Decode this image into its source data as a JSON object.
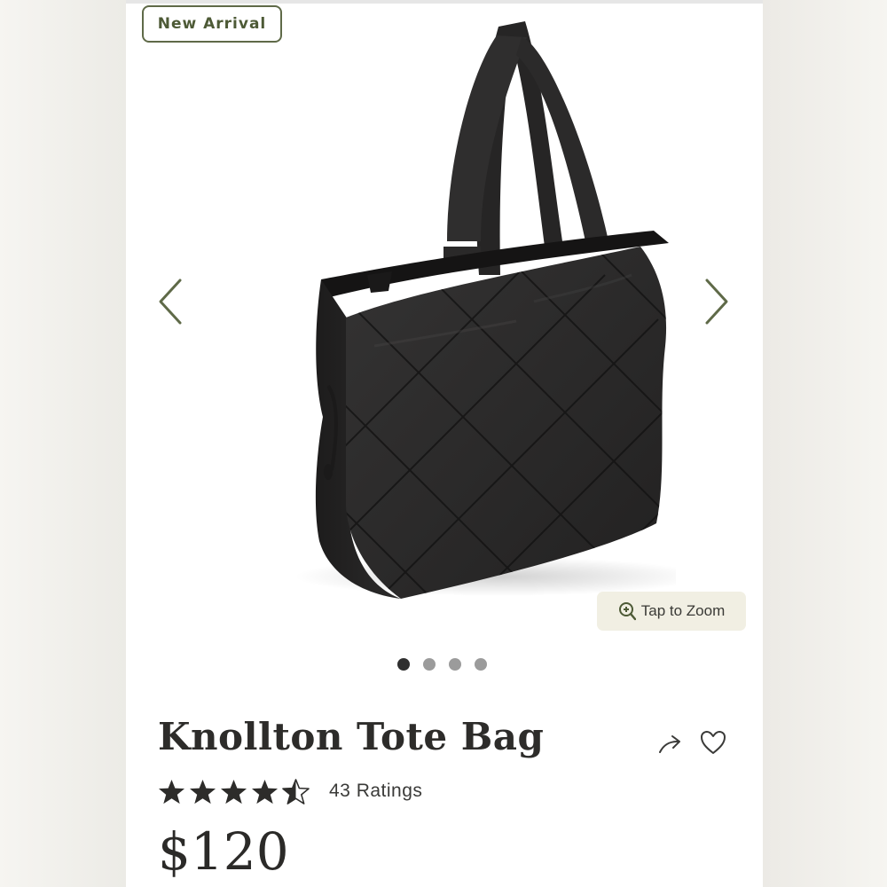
{
  "badge": {
    "label": "New Arrival"
  },
  "gallery": {
    "image_alt": "Knollton Tote Bag quilted black tote",
    "zoom_label": "Tap to Zoom",
    "slide_count": 4,
    "active_slide": 1
  },
  "product": {
    "title": "Knollton Tote Bag",
    "rating": 4.5,
    "ratings_label": "43 Ratings",
    "price": "$120"
  },
  "icons": {
    "prev": "chevron-left-icon",
    "next": "chevron-right-icon",
    "zoom": "magnifier-plus-icon",
    "share": "share-arrow-icon",
    "favorite": "heart-outline-icon",
    "star": "star-icon"
  },
  "colors": {
    "accent_olive": "#5f6a48",
    "zoom_pill_bg": "#f1efe3",
    "bag_black": "#2a2929",
    "dot_active": "#2f2f2f",
    "dot_inactive": "#9b9b9b"
  }
}
